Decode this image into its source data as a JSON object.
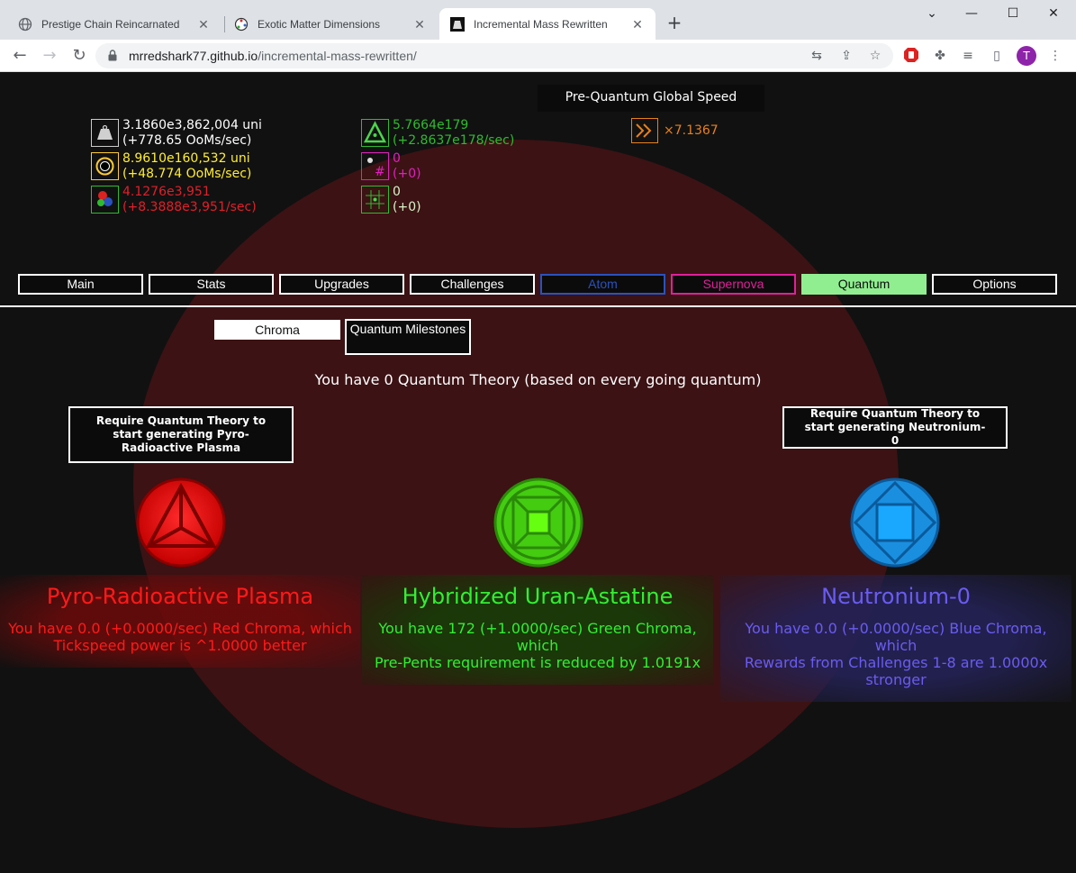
{
  "browser": {
    "tabs": [
      {
        "title": "Prestige Chain Reincarnated",
        "active": false
      },
      {
        "title": "Exotic Matter Dimensions",
        "active": false
      },
      {
        "title": "Incremental Mass Rewritten",
        "active": true
      }
    ],
    "url_host": "mrredshark77.github.io",
    "url_path": "/incremental-mass-rewritten/",
    "avatar_letter": "T"
  },
  "header": {
    "speed_title": "Pre-Quantum Global Speed",
    "speed_value": "×7.1367"
  },
  "resources": {
    "mass": {
      "value": "3.1860e3,862,004 uni",
      "rate": "(+778.65 OoMs/sec)",
      "color": "#ffffff"
    },
    "black_hole": {
      "value": "8.9610e160,532 uni",
      "rate": "(+48.774 OoMs/sec)",
      "color": "#ffee33"
    },
    "atom": {
      "value": "4.1276e3,951",
      "rate": "(+8.3888e3,951/sec)",
      "color": "#e0202a"
    },
    "supernova_gen": {
      "value": "5.7664e179",
      "rate": "(+2.8637e178/sec)",
      "color": "#2fbb2f"
    },
    "stars": {
      "value": "0",
      "rate": "(+0)",
      "color": "#e020c0"
    },
    "quantum_foam": {
      "value": "0",
      "rate": "(+0)",
      "color": "#d8f4c8"
    }
  },
  "main_tabs": [
    {
      "label": "Main",
      "color": "#ffffff",
      "border": "#ffffff",
      "bg": "#0b0b0b"
    },
    {
      "label": "Stats",
      "color": "#ffffff",
      "border": "#ffffff",
      "bg": "#0b0b0b"
    },
    {
      "label": "Upgrades",
      "color": "#ffffff",
      "border": "#ffffff",
      "bg": "#0b0b0b"
    },
    {
      "label": "Challenges",
      "color": "#ffffff",
      "border": "#ffffff",
      "bg": "#0b0b0b"
    },
    {
      "label": "Atom",
      "color": "#2a52be",
      "border": "#2a52be",
      "bg": "#0b0b0b"
    },
    {
      "label": "Supernova",
      "color": "#e0209a",
      "border": "#e0209a",
      "bg": "#0b0b0b"
    },
    {
      "label": "Quantum",
      "color": "#0b0b0b",
      "border": "#90ee90",
      "bg": "#90ee90"
    },
    {
      "label": "Options",
      "color": "#ffffff",
      "border": "#ffffff",
      "bg": "#0b0b0b"
    }
  ],
  "sub_tabs": [
    {
      "label": "Chroma",
      "active": true
    },
    {
      "label": "Quantum Milestones",
      "active": false
    }
  ],
  "theory_text": "You have 0 Quantum Theory (based on every going quantum)",
  "requirements": {
    "red": "Require Quantum Theory to start generating Pyro-Radioactive Plasma",
    "blue": "Require Quantum Theory to start generating Neutronium-0"
  },
  "chroma": [
    {
      "name": "Pyro-Radioactive Plasma",
      "desc_1": "You have 0.0 (+0.0000/sec) Red Chroma, which",
      "desc_2": "Tickspeed power is ^1.0000 better",
      "color": "#ff1a1a"
    },
    {
      "name": "Hybridized Uran-Astatine",
      "desc_1": "You have 172 (+1.0000/sec) Green Chroma, which",
      "desc_2": "Pre-Pents requirement is reduced by 1.0191x",
      "color": "#33ee33"
    },
    {
      "name": "Neutronium-0",
      "desc_1": "You have 0.0 (+0.0000/sec) Blue Chroma, which",
      "desc_2": "Rewards from Challenges 1-8 are 1.0000x stronger",
      "color": "#6a5cf0"
    }
  ]
}
